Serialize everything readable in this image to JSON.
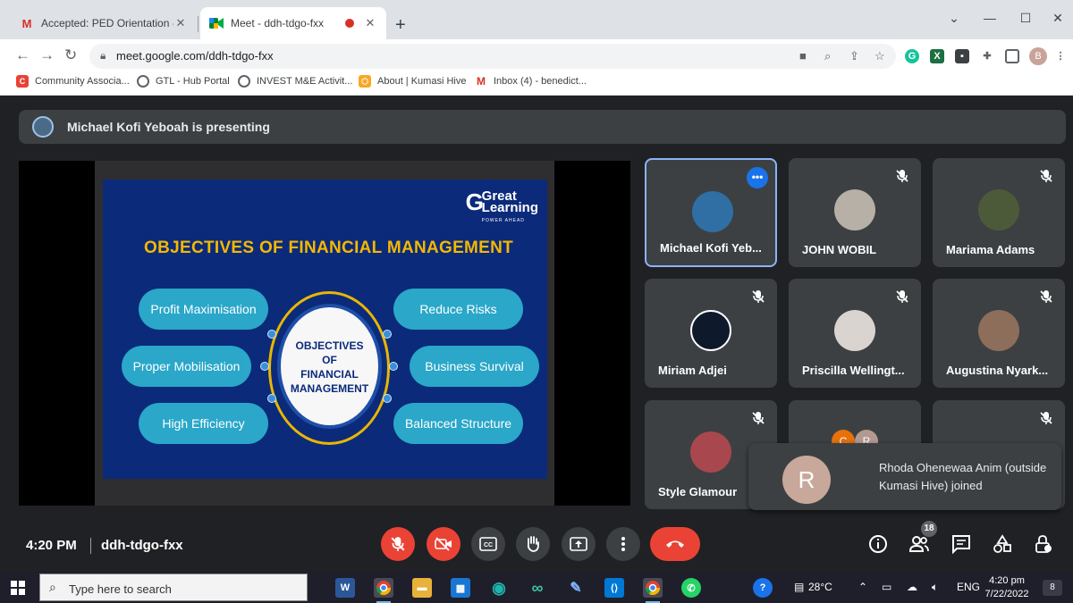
{
  "browser": {
    "tabs": [
      {
        "title": "Accepted: PED Orientation @ Mo",
        "icon": "gmail-icon"
      },
      {
        "title": "Meet - ddh-tdgo-fxx",
        "icon": "meet-icon",
        "recording": true
      }
    ],
    "new_tab": "+",
    "url": "meet.google.com/ddh-tdgo-fxx",
    "profile_initial": "B",
    "bookmarks": [
      {
        "label": "Community Associa...",
        "icon": "bookmark-community-icon"
      },
      {
        "label": "GTL - Hub Portal",
        "icon": "globe-icon"
      },
      {
        "label": "INVEST M&E Activit...",
        "icon": "globe-icon"
      },
      {
        "label": "About | Kumasi Hive",
        "icon": "hive-icon"
      },
      {
        "label": "Inbox (4) - benedict...",
        "icon": "gmail-icon"
      }
    ]
  },
  "meet": {
    "presenting_text": "Michael Kofi Yeboah is presenting",
    "slide": {
      "logo_line1": "Great",
      "logo_line2": "Learning",
      "logo_tag": "POWER AHEAD",
      "heading": "OBJECTIVES OF FINANCIAL MANAGEMENT",
      "center": [
        "OBJECTIVES",
        "OF",
        "FINANCIAL",
        "MANAGEMENT"
      ],
      "left_items": [
        "Profit Maximisation",
        "Proper Mobilisation",
        "High Efficiency"
      ],
      "right_items": [
        "Reduce Risks",
        "Business Survival",
        "Balanced Structure"
      ]
    },
    "participants": [
      {
        "name": "Michael Kofi Yeb...",
        "speaking": true
      },
      {
        "name": "JOHN WOBIL"
      },
      {
        "name": "Mariama Adams"
      },
      {
        "name": "Miriam Adjei"
      },
      {
        "name": "Priscilla Wellingt..."
      },
      {
        "name": "Augustina Nyark..."
      },
      {
        "name": "Style Glamour"
      }
    ],
    "more_tile_initials": [
      "C",
      "R"
    ],
    "toast": {
      "initial": "R",
      "message": "Rhoda Ohenewaa Anim (outside Kumasi Hive) joined"
    },
    "controls": {
      "time": "4:20 PM",
      "meeting_code": "ddh-tdgo-fxx",
      "participants_count": "18"
    }
  },
  "taskbar": {
    "search_placeholder": "Type here to search",
    "weather": "28°C",
    "language": "ENG",
    "time": "4:20 pm",
    "date": "7/22/2022",
    "notifications": "8"
  },
  "colors": {
    "meet_bg": "#202124",
    "tile_bg": "#3c4043",
    "red": "#ea4335",
    "slide_bg": "#0b2a7a",
    "slide_heading": "#f5b800",
    "pill": "#2aa7c9"
  }
}
